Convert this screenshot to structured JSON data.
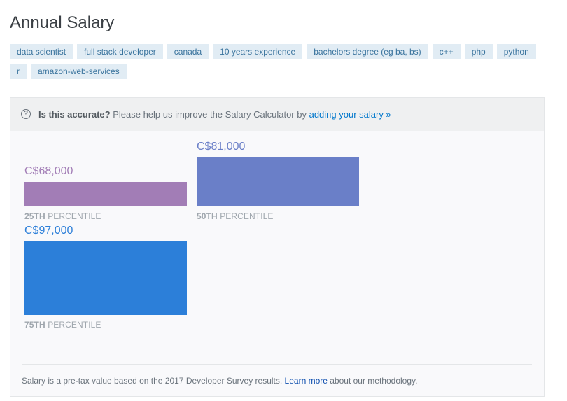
{
  "header": {
    "title": "Annual Salary"
  },
  "tags": [
    "data scientist",
    "full stack developer",
    "canada",
    "10 years experience",
    "bachelors degree (eg ba, bs)",
    "c++",
    "php",
    "python",
    "r",
    "amazon-web-services"
  ],
  "notice": {
    "icon": "question-circle-icon",
    "strong": "Is this accurate?",
    "text": " Please help us improve the Salary Calculator by ",
    "link": "adding your salary »"
  },
  "chart_data": {
    "type": "bar",
    "title": "Annual Salary",
    "currency": "C$",
    "categories": [
      "25th percentile",
      "50th percentile",
      "75th percentile"
    ],
    "values": [
      68000,
      81000,
      97000
    ],
    "bars": [
      {
        "value_label": "C$68,000",
        "rank_label": "25TH",
        "label": "PERCENTILE",
        "value": 68000,
        "color": "#a27db6"
      },
      {
        "value_label": "C$81,000",
        "rank_label": "50TH",
        "label": "PERCENTILE",
        "value": 81000,
        "color": "#6a7fc8"
      },
      {
        "value_label": "C$97,000",
        "rank_label": "75TH",
        "label": "PERCENTILE",
        "value": 97000,
        "color": "#2c7fd9"
      }
    ],
    "xlabel": "",
    "ylabel": "",
    "grid": false,
    "legend": "none"
  },
  "footer": {
    "text_before": "Salary is a pre-tax value based on the 2017 Developer Survey results. ",
    "link": "Learn more",
    "text_after": " about our methodology."
  },
  "colors": {
    "tag_bg": "#e1ecf4",
    "tag_text": "#39739d",
    "link": "#0077cc"
  }
}
